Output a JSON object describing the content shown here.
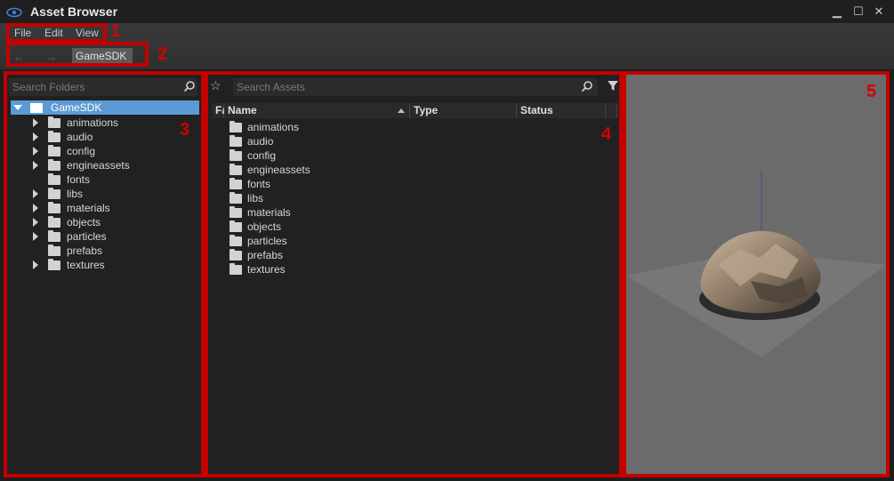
{
  "window": {
    "title": "Asset Browser",
    "minimize_glyph": "▁",
    "maximize_glyph": "☐",
    "close_glyph": "✕"
  },
  "menu": [
    {
      "label": "File"
    },
    {
      "label": "Edit"
    },
    {
      "label": "View"
    }
  ],
  "nav": {
    "back_glyph": "←",
    "forward_glyph": "→",
    "breadcrumb": "GameSDK"
  },
  "annotations": [
    "1",
    "2",
    "3",
    "4",
    "5"
  ],
  "folders_panel": {
    "search_placeholder": "Search Folders",
    "root": "GameSDK",
    "items": [
      {
        "label": "animations",
        "expandable": true
      },
      {
        "label": "audio",
        "expandable": true
      },
      {
        "label": "config",
        "expandable": true
      },
      {
        "label": "engineassets",
        "expandable": true
      },
      {
        "label": "fonts",
        "expandable": false
      },
      {
        "label": "libs",
        "expandable": true
      },
      {
        "label": "materials",
        "expandable": true
      },
      {
        "label": "objects",
        "expandable": true
      },
      {
        "label": "particles",
        "expandable": true
      },
      {
        "label": "prefabs",
        "expandable": false
      },
      {
        "label": "textures",
        "expandable": true
      }
    ]
  },
  "assets_panel": {
    "search_placeholder": "Search Assets",
    "favorite_glyph": "☆",
    "filter_glyph": "▼",
    "columns": {
      "favorite": "Fa",
      "name": "Name",
      "type": "Type",
      "status": "Status"
    },
    "rows": [
      "animations",
      "audio",
      "config",
      "engineassets",
      "fonts",
      "libs",
      "materials",
      "objects",
      "particles",
      "prefabs",
      "textures"
    ]
  },
  "colors": {
    "accent_selection": "#5b9bd5",
    "annotation_red": "#c40000",
    "preview_bg": "#6b6b6b"
  }
}
